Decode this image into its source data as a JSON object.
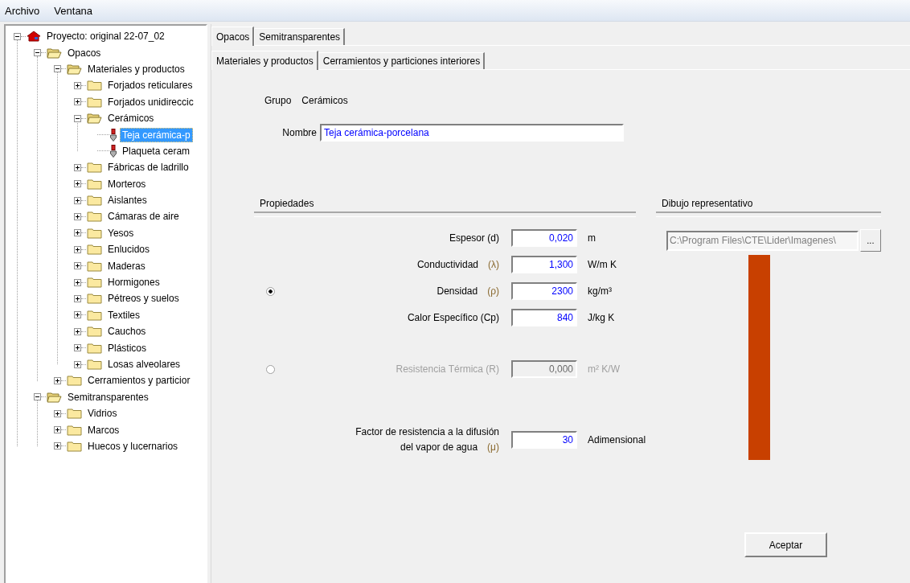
{
  "menu": [
    {
      "label": "Archivo"
    },
    {
      "label": "Ventana"
    }
  ],
  "tree": [
    {
      "label": "Proyecto: original 22-07_02",
      "kind": "project",
      "expanded": true,
      "selected": false,
      "children": [
        {
          "label": "Opacos",
          "kind": "folder",
          "expanded": true,
          "selected": false,
          "children": [
            {
              "label": "Materiales y productos",
              "kind": "folder",
              "expanded": true,
              "selected": false,
              "children": [
                {
                  "label": "Forjados reticulares",
                  "kind": "folder",
                  "expanded": false,
                  "selected": false
                },
                {
                  "label": "Forjados unidireccic",
                  "kind": "folder",
                  "expanded": false,
                  "selected": false
                },
                {
                  "label": "Cerámicos",
                  "kind": "folder",
                  "expanded": true,
                  "selected": false,
                  "children": [
                    {
                      "label": "Teja cerámica-p",
                      "kind": "material",
                      "selected": true
                    },
                    {
                      "label": "Plaqueta ceram",
                      "kind": "material",
                      "selected": false
                    }
                  ]
                },
                {
                  "label": "Fábricas de ladrillo",
                  "kind": "folder",
                  "expanded": false,
                  "selected": false
                },
                {
                  "label": "Morteros",
                  "kind": "folder",
                  "expanded": false,
                  "selected": false
                },
                {
                  "label": "Aislantes",
                  "kind": "folder",
                  "expanded": false,
                  "selected": false
                },
                {
                  "label": "Cámaras de aire",
                  "kind": "folder",
                  "expanded": false,
                  "selected": false
                },
                {
                  "label": "Yesos",
                  "kind": "folder",
                  "expanded": false,
                  "selected": false
                },
                {
                  "label": "Enlucidos",
                  "kind": "folder",
                  "expanded": false,
                  "selected": false
                },
                {
                  "label": "Maderas",
                  "kind": "folder",
                  "expanded": false,
                  "selected": false
                },
                {
                  "label": "Hormigones",
                  "kind": "folder",
                  "expanded": false,
                  "selected": false
                },
                {
                  "label": "Pétreos y suelos",
                  "kind": "folder",
                  "expanded": false,
                  "selected": false
                },
                {
                  "label": "Textiles",
                  "kind": "folder",
                  "expanded": false,
                  "selected": false
                },
                {
                  "label": "Cauchos",
                  "kind": "folder",
                  "expanded": false,
                  "selected": false
                },
                {
                  "label": "Plásticos",
                  "kind": "folder",
                  "expanded": false,
                  "selected": false
                },
                {
                  "label": "Losas alveolares",
                  "kind": "folder",
                  "expanded": false,
                  "selected": false
                }
              ]
            },
            {
              "label": "Cerramientos y particior",
              "kind": "folder",
              "expanded": false,
              "selected": false
            }
          ]
        },
        {
          "label": "Semitransparentes",
          "kind": "folder",
          "expanded": true,
          "selected": false,
          "children": [
            {
              "label": "Vidrios",
              "kind": "folder",
              "expanded": false,
              "selected": false
            },
            {
              "label": "Marcos",
              "kind": "folder",
              "expanded": false,
              "selected": false
            },
            {
              "label": "Huecos y lucernarios",
              "kind": "folder",
              "expanded": false,
              "selected": false
            }
          ]
        }
      ]
    }
  ],
  "tabs": [
    {
      "label": "Opacos",
      "selected": true
    },
    {
      "label": "Semitransparentes",
      "selected": false
    }
  ],
  "subtabs": [
    {
      "label": "Materiales y productos",
      "selected": true
    },
    {
      "label": "Cerramientos y particiones interiores",
      "selected": false
    }
  ],
  "form": {
    "group_label": "Grupo",
    "group_value": "Cerámicos",
    "name_label": "Nombre",
    "name_value": "Teja cerámica-porcelana"
  },
  "properties": {
    "title": "Propiedades",
    "thickness": {
      "label": "Espesor (d)",
      "value": "0,020",
      "unit": "m"
    },
    "options": [
      {
        "selected": true,
        "rows": [
          {
            "label": "Conductividad",
            "symbol": "(λ)",
            "value": "1,300",
            "unit": "W/m K"
          },
          {
            "label": "Densidad",
            "symbol": "(ρ)",
            "value": "2300",
            "unit": "kg/m³"
          },
          {
            "label": "Calor Específico (Cp)",
            "value": "840",
            "unit": "J/kg K"
          }
        ]
      },
      {
        "selected": false,
        "rows": [
          {
            "label": "Resistencia Térmica (R)",
            "value": "0,000",
            "unit": "m² K/W"
          }
        ]
      }
    ],
    "vapor": {
      "label_lines": [
        "Factor de resistencia a la difusión",
        "del vapor de agua"
      ],
      "symbol": "(μ)",
      "value": "30",
      "unit": "Adimensional"
    }
  },
  "drawing": {
    "title": "Dibujo representativo",
    "path": "C:\\Program Files\\CTE\\Lider\\Imagenes\\",
    "browse": "..."
  },
  "accept": "Aceptar"
}
